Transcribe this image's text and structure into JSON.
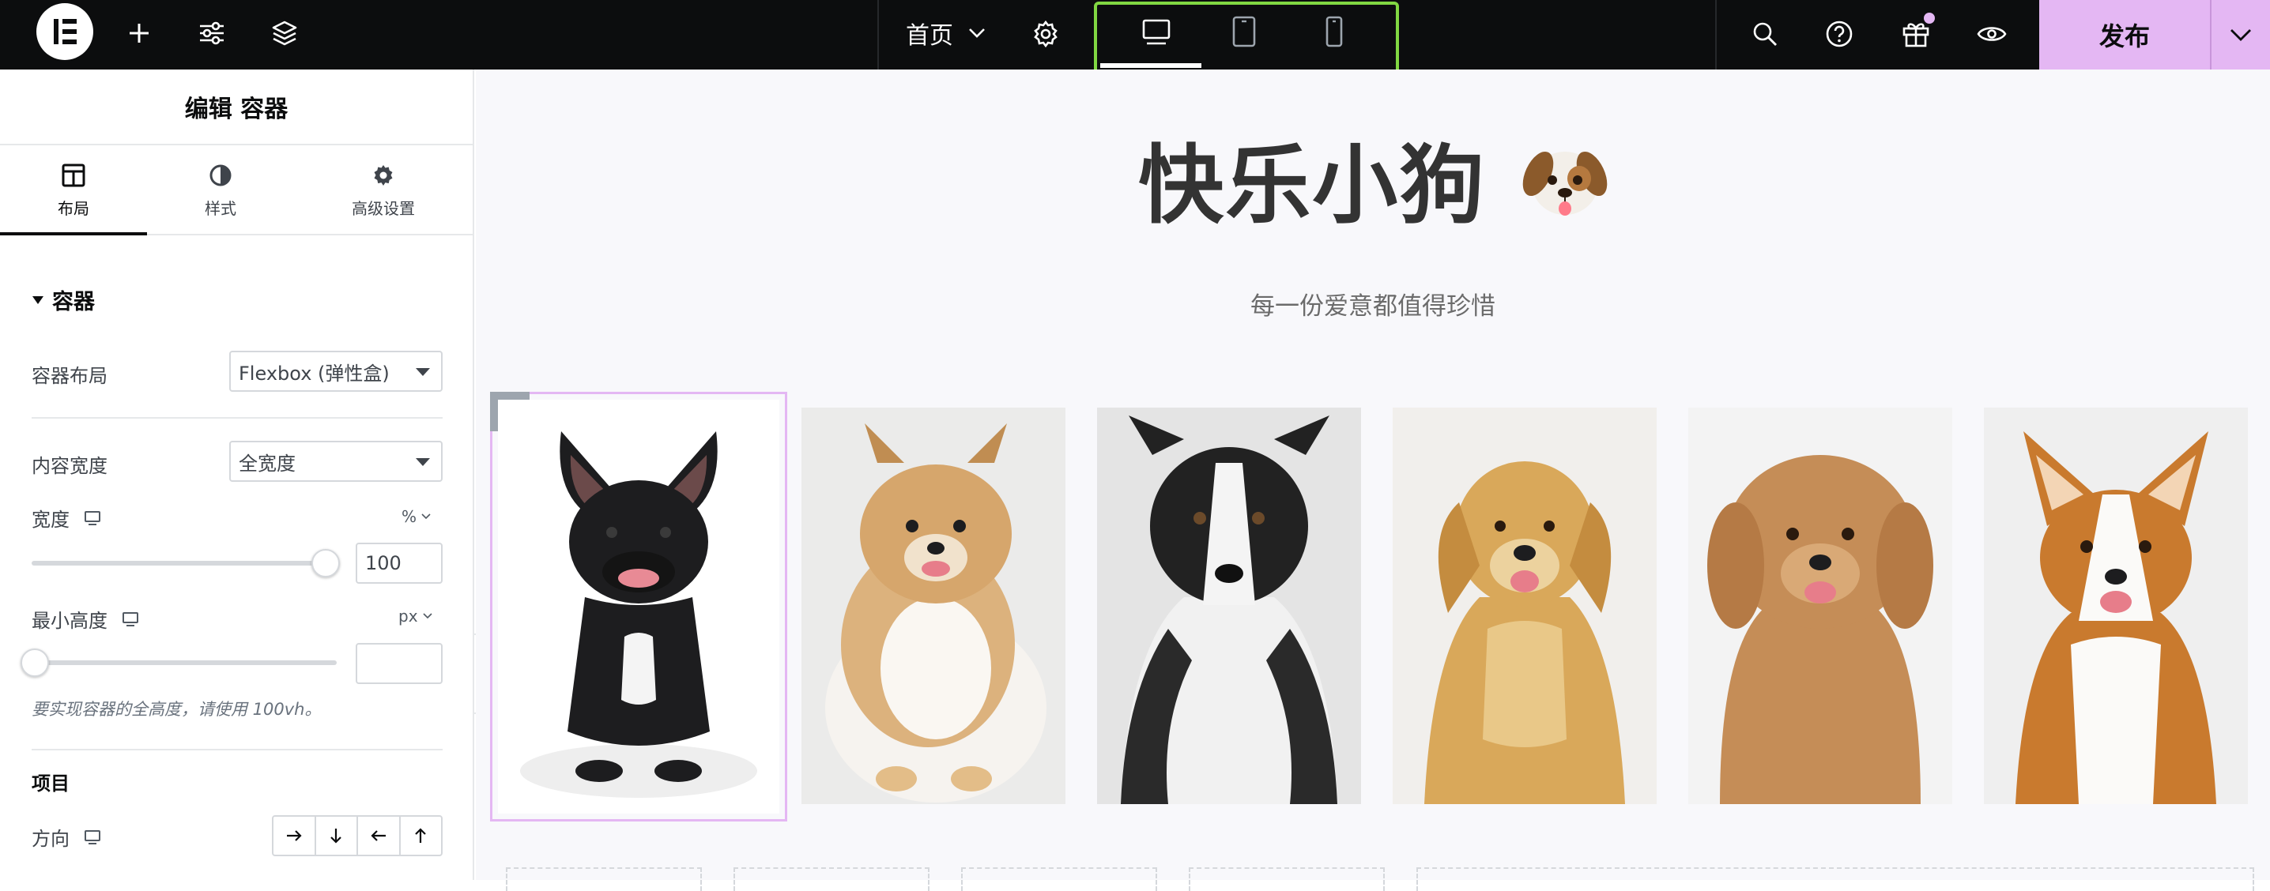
{
  "topbar": {
    "page_name": "首页",
    "publish_label": "发布"
  },
  "panel": {
    "title": "编辑 容器",
    "tabs": [
      {
        "label": "布局",
        "active": true
      },
      {
        "label": "样式",
        "active": false
      },
      {
        "label": "高级设置",
        "active": false
      }
    ],
    "section_title": "容器",
    "container_layout": {
      "label": "容器布局",
      "value": "Flexbox (弹性盒)"
    },
    "content_width": {
      "label": "内容宽度",
      "value": "全宽度"
    },
    "width": {
      "label": "宽度",
      "unit": "%",
      "value": "100",
      "fraction": 1.0
    },
    "min_height": {
      "label": "最小高度",
      "unit": "px",
      "value": "",
      "fraction": 0.0
    },
    "hint": "要实现容器的全高度，请使用 100vh。",
    "items_title": "项目",
    "direction_label": "方向"
  },
  "canvas": {
    "title": "快乐小狗",
    "subtitle": "每一份爱意都值得珍惜",
    "dogs": [
      {
        "breed": "French Bulldog",
        "coat": "#1d1d1f",
        "accent": "#ffffff"
      },
      {
        "breed": "Pomeranian",
        "coat": "#d6a66c",
        "accent": "#ffffff"
      },
      {
        "breed": "Border Collie",
        "coat": "#222222",
        "accent": "#ffffff"
      },
      {
        "breed": "Golden Retriever",
        "coat": "#d9a85a",
        "accent": "#e9c888"
      },
      {
        "breed": "Poodle",
        "coat": "#c58d57",
        "accent": "#d9a976"
      },
      {
        "breed": "Corgi",
        "coat": "#c97a2e",
        "accent": "#ffffff"
      }
    ]
  },
  "colors": {
    "topbar_bg": "#0c0d0e",
    "device_highlight": "#81d742",
    "publish_bg": "#e4b7f3",
    "selection": "#e4b7f3",
    "canvas_bg": "#f8f8fb"
  }
}
